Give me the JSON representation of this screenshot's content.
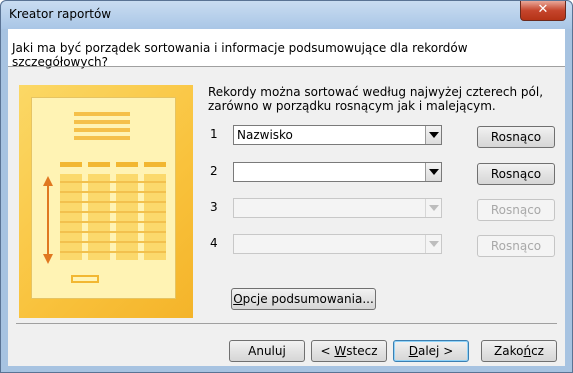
{
  "window": {
    "title": "Kreator raportów",
    "close_glyph": "✕"
  },
  "header": {
    "question": "Jaki ma być porządek sortowania i informacje podsumowujące dla rekordów szczegółowych?"
  },
  "description": "Rekordy można sortować według najwyżej czterech pól, zarówno w porządku rosnącym jak i malejącym.",
  "sort_rows": [
    {
      "number": "1",
      "field": "Nazwisko",
      "order": "Rosnąco",
      "enabled": true
    },
    {
      "number": "2",
      "field": "",
      "order": "Rosnąco",
      "enabled": true
    },
    {
      "number": "3",
      "field": "",
      "order": "Rosnąco",
      "enabled": false
    },
    {
      "number": "4",
      "field": "",
      "order": "Rosnąco",
      "enabled": false
    }
  ],
  "summary_button": {
    "pre": "",
    "accel": "O",
    "post": "pcje podsumowania..."
  },
  "footer": {
    "cancel": {
      "pre": "Anuluj",
      "accel": "",
      "post": ""
    },
    "back": {
      "pre": "< ",
      "accel": "W",
      "post": "stecz"
    },
    "next": {
      "pre": "",
      "accel": "D",
      "post": "alej >"
    },
    "finish": {
      "pre": "Zako",
      "accel": "ń",
      "post": "cz"
    }
  },
  "colors": {
    "illustration": "#f9c23c",
    "paper": "#fff3b4",
    "arrow": "#e07820"
  }
}
